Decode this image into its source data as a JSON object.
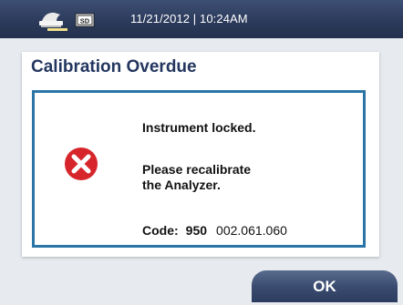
{
  "status_bar": {
    "datetime": "11/21/2012 | 10:24AM",
    "icons": [
      "printer-icon",
      "sd-card-icon"
    ],
    "sd_label": "SD"
  },
  "dialog": {
    "title": "Calibration Overdue",
    "message_line1": "Instrument locked.",
    "message_line2": "Please recalibrate",
    "message_line3": "the Analyzer.",
    "code_label": "Code:",
    "code_number": "950",
    "code_value": "002.061.060",
    "icon": "error-x-icon"
  },
  "buttons": {
    "ok": "OK"
  },
  "colors": {
    "header_bg": "#2c3b5c",
    "title_text": "#23365f",
    "box_border": "#2b74a6",
    "error_red": "#d7262b"
  }
}
